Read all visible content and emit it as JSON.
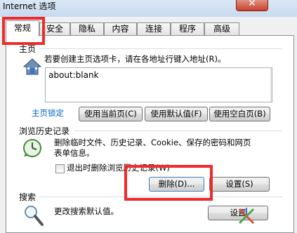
{
  "window": {
    "title": "Internet 选项",
    "close_glyph": "✕"
  },
  "tabs": [
    {
      "label": "常规",
      "active": true
    },
    {
      "label": "安全"
    },
    {
      "label": "隐私"
    },
    {
      "label": "内容"
    },
    {
      "label": "连接"
    },
    {
      "label": "程序"
    },
    {
      "label": "高级"
    }
  ],
  "home": {
    "group_label": "主页",
    "instruction": "若要创建主页选项卡，请在各地址行键入地址(R)。",
    "url_value": "about:blank",
    "lock_link": "主页锁定",
    "use_current": "使用当前页(C)",
    "use_default": "使用默认值(F)",
    "use_blank": "使用空白页(B)"
  },
  "history": {
    "group_label": "浏览历史记录",
    "desc_line1": "删除临时文件、历史记录、Cookie、保存的密码和网页",
    "desc_line2": "表单信息。",
    "checkbox_label": "退出时删除浏览历史记录(W)",
    "delete_button": "删除(D)...",
    "settings_button": "设置(S)"
  },
  "search": {
    "group_label": "搜索",
    "desc": "更改搜索默认值。",
    "settings_button": "设置"
  },
  "colors": {
    "highlight": "#ee2b2b",
    "link": "#0066cc"
  }
}
